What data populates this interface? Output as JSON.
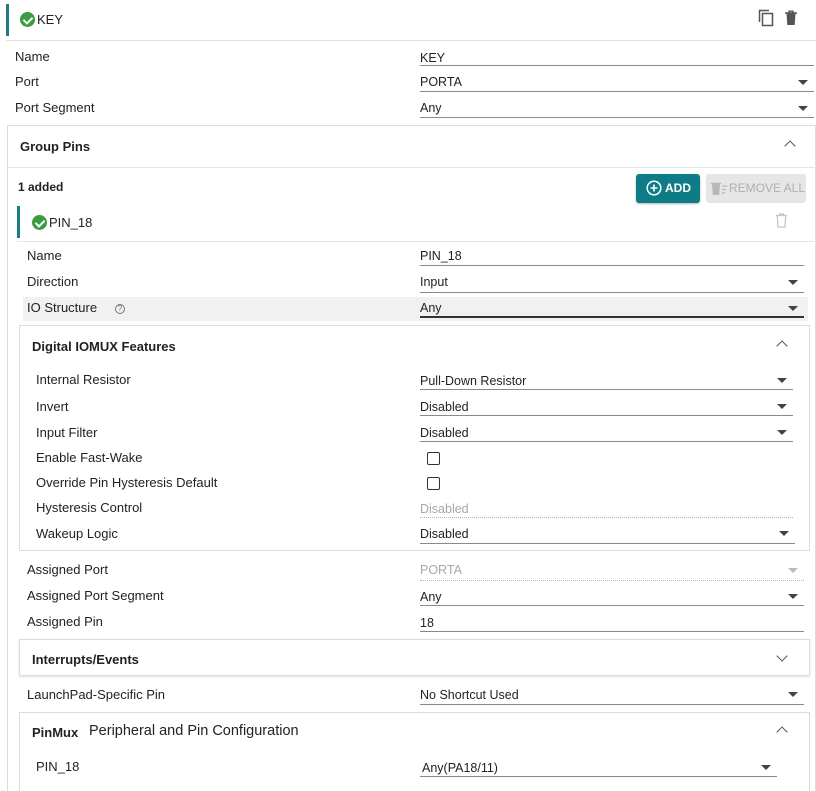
{
  "header": {
    "title": "KEY"
  },
  "top_fields": {
    "name_label": "Name",
    "name_value": "KEY",
    "port_label": "Port",
    "port_value": "PORTA",
    "port_segment_label": "Port Segment",
    "port_segment_value": "Any"
  },
  "group_pins": {
    "title": "Group Pins",
    "count": "1 added",
    "add_label": "ADD",
    "remove_all_label": "REMOVE ALL"
  },
  "pin": {
    "title": "PIN_18",
    "name_label": "Name",
    "name_value": "PIN_18",
    "direction_label": "Direction",
    "direction_value": "Input",
    "io_structure_label": "IO Structure",
    "io_structure_value": "Any"
  },
  "iomux": {
    "title": "Digital IOMUX Features",
    "internal_resistor_label": "Internal Resistor",
    "internal_resistor_value": "Pull-Down Resistor",
    "invert_label": "Invert",
    "invert_value": "Disabled",
    "input_filter_label": "Input Filter",
    "input_filter_value": "Disabled",
    "fast_wake_label": "Enable Fast-Wake",
    "fast_wake_checked": false,
    "override_hyst_label": "Override Pin Hysteresis Default",
    "override_hyst_checked": false,
    "hyst_control_label": "Hysteresis Control",
    "hyst_control_value": "Disabled",
    "wakeup_logic_label": "Wakeup Logic",
    "wakeup_logic_value": "Disabled"
  },
  "assigned": {
    "port_label": "Assigned Port",
    "port_value": "PORTA",
    "segment_label": "Assigned Port Segment",
    "segment_value": "Any",
    "pin_label": "Assigned Pin",
    "pin_value": "18"
  },
  "interrupts": {
    "title": "Interrupts/Events"
  },
  "launchpad": {
    "label": "LaunchPad-Specific Pin",
    "value": "No Shortcut Used"
  },
  "pinmux": {
    "title_bold": "PinMux",
    "title": "Peripheral and Pin Configuration",
    "pin_label": "PIN_18",
    "pin_value": "Any(PA18/11)"
  },
  "colors": {
    "accent": "#1f7a82",
    "button": "#0e7c86",
    "success": "#3a9b3f"
  }
}
